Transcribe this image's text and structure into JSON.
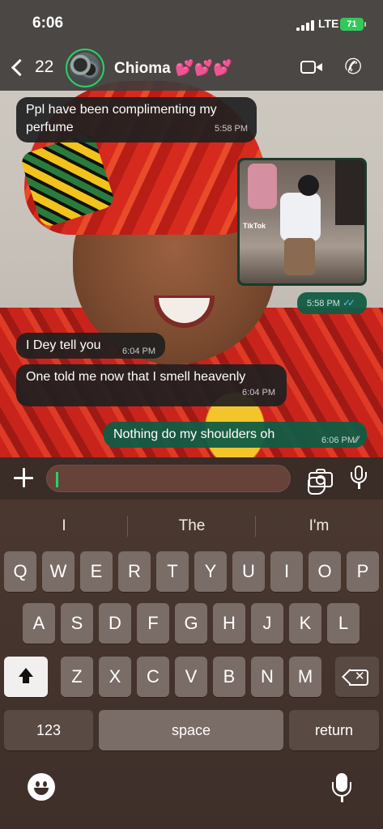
{
  "status_bar": {
    "time": "6:06",
    "network": "LTE",
    "battery": "71"
  },
  "header": {
    "back_count": "22",
    "contact_name": "Chioma 💕💕💕"
  },
  "messages": [
    {
      "direction": "in",
      "text": "Ppl have been complimenting my perfume",
      "time": "5:58 PM"
    },
    {
      "direction": "out",
      "type": "image",
      "overlay_text": "TikTok",
      "time": "5:58 PM",
      "status": "read"
    },
    {
      "direction": "in",
      "text": "I Dey tell you",
      "time": "6:04 PM"
    },
    {
      "direction": "in",
      "text": "One told me now that I smell heavenly",
      "time": "6:04 PM"
    },
    {
      "direction": "out",
      "text": "Nothing do my shoulders oh",
      "time": "6:06 PM",
      "status": "read"
    }
  ],
  "composer": {
    "placeholder": ""
  },
  "keyboard": {
    "suggestions": [
      "I",
      "The",
      "I'm"
    ],
    "row1": [
      "Q",
      "W",
      "E",
      "R",
      "T",
      "Y",
      "U",
      "I",
      "O",
      "P"
    ],
    "row2": [
      "A",
      "S",
      "D",
      "F",
      "G",
      "H",
      "J",
      "K",
      "L"
    ],
    "row3": [
      "Z",
      "X",
      "C",
      "V",
      "B",
      "N",
      "M"
    ],
    "numbers_label": "123",
    "space_label": "space",
    "return_label": "return"
  },
  "colors": {
    "incoming_bubble": "#202020",
    "outgoing_bubble": "#115c45",
    "accent_green": "#25d366",
    "read_ticks": "#53bdeb",
    "battery": "#34c759"
  }
}
